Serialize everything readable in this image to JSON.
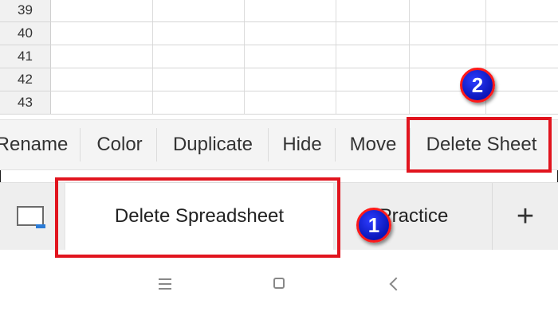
{
  "grid": {
    "rows": [
      "39",
      "40",
      "41",
      "42",
      "43"
    ]
  },
  "context_menu": {
    "items": [
      "Rename",
      "Color",
      "Duplicate",
      "Hide",
      "Move",
      "Delete Sheet"
    ]
  },
  "sheet_tabs": {
    "active_tab": "Delete Spreadsheet",
    "other_tab": "Practice",
    "add_label": "+"
  },
  "annotations": {
    "step1": "1",
    "step2": "2",
    "highlight_color": "#e1141e",
    "badge_color": "#0a16b8"
  },
  "icons": {
    "sheet_list": "sheet-list-icon",
    "add": "plus-icon",
    "nav_recent": "menu-lines-icon",
    "nav_home": "square-icon",
    "nav_back": "chevron-left-icon"
  }
}
